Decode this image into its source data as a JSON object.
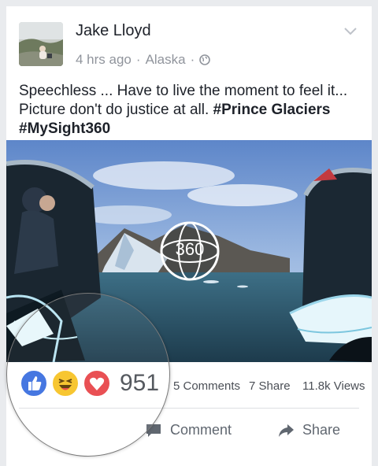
{
  "post": {
    "author": "Jake Lloyd",
    "time": "4 hrs ago",
    "location": "Alaska",
    "text_plain": "Speechless ... Have to live the moment to feel it... Picture don't do justice at all.",
    "hashtag1": "#Prince Glaciers",
    "hashtag2": "#MySight360",
    "video_badge": "360"
  },
  "stats": {
    "reactions_count": "951",
    "comments": "5 Comments",
    "shares": "7 Share",
    "views": "11.8k Views",
    "reactions": [
      "like-icon",
      "haha-icon",
      "love-icon"
    ]
  },
  "actions": {
    "comment": "Comment",
    "share": "Share"
  },
  "colors": {
    "like": "#3b6fe0",
    "haha": "#f7c325",
    "love": "#e8464a",
    "text": "#1d2129",
    "muted": "#90949c"
  }
}
